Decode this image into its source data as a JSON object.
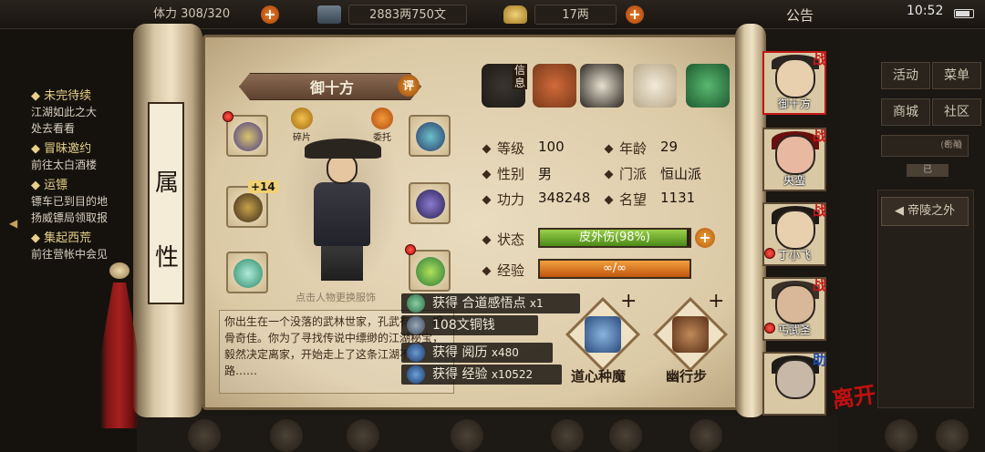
{
  "topbar": {
    "stamina": "体力 308/320",
    "money": "2883两750文",
    "gold": "17两",
    "announcement": "公告",
    "time": "10:52"
  },
  "quests": [
    {
      "title": "未完待续",
      "desc": [
        "江湖如此之大",
        "处去看看"
      ]
    },
    {
      "title": "冒昧邀约",
      "desc": [
        "前往太白酒楼"
      ]
    },
    {
      "title": "运镖",
      "desc": [
        "镖车已到目的地",
        "扬威镖局领取报"
      ]
    },
    {
      "title": "集起西荒",
      "desc": [
        "前往营帐中会见"
      ]
    }
  ],
  "right_menu": {
    "buttons": [
      "活动",
      "菜单",
      "商城",
      "社区"
    ],
    "location": "帝陵",
    "location_coord": "(8,4)",
    "tab": "已",
    "exit_label": "帝陵之外"
  },
  "scroll": {
    "attr_chars": [
      "属",
      "性"
    ]
  },
  "character": {
    "name": "御十方",
    "rate_label": "评",
    "fragment_label": "碎片",
    "entrust_label": "委托",
    "enhance": "+14",
    "tap_hint": "点击人物更换服饰",
    "description": "你出生在一个没落的武林世家，孔武有力，根骨奇佳。你为了寻找传说中缥缈的江湖秘宝，毅然决定离家，开始走上了这条江湖不归路……"
  },
  "tabs": {
    "info_label": "信息"
  },
  "stats": {
    "level_label": "等级",
    "level": "100",
    "age_label": "年龄",
    "age": "29",
    "gender_label": "性别",
    "gender": "男",
    "sect_label": "门派",
    "sect": "恒山派",
    "power_label": "功力",
    "power": "348248",
    "fame_label": "名望",
    "fame": "1131",
    "status_label": "状态",
    "status_text": "皮外伤(98%)",
    "status_pct": 98,
    "exp_label": "经验",
    "exp_text": "∞/∞"
  },
  "skills": [
    {
      "name": "道心种魔"
    },
    {
      "name": "幽行步"
    }
  ],
  "rewards": [
    {
      "text": "获得 合道感悟点",
      "count": "x1"
    },
    {
      "text": "108文铜钱",
      "count": ""
    },
    {
      "text": "获得 阅历",
      "count": "x480"
    },
    {
      "text": "获得 经验",
      "count": "x10522"
    }
  ],
  "party": [
    {
      "name": "御十方",
      "tag": "战"
    },
    {
      "name": "央蛮",
      "tag": "战"
    },
    {
      "name": "丁小飞",
      "tag": "战"
    },
    {
      "name": "丐武圣",
      "tag": "战"
    },
    {
      "name": "",
      "tag": "助"
    }
  ],
  "leave_label": "离开",
  "colors": {
    "status_bar": "#6fae2a",
    "exp_bar": "#e0781c",
    "accent_red": "#c01818"
  }
}
